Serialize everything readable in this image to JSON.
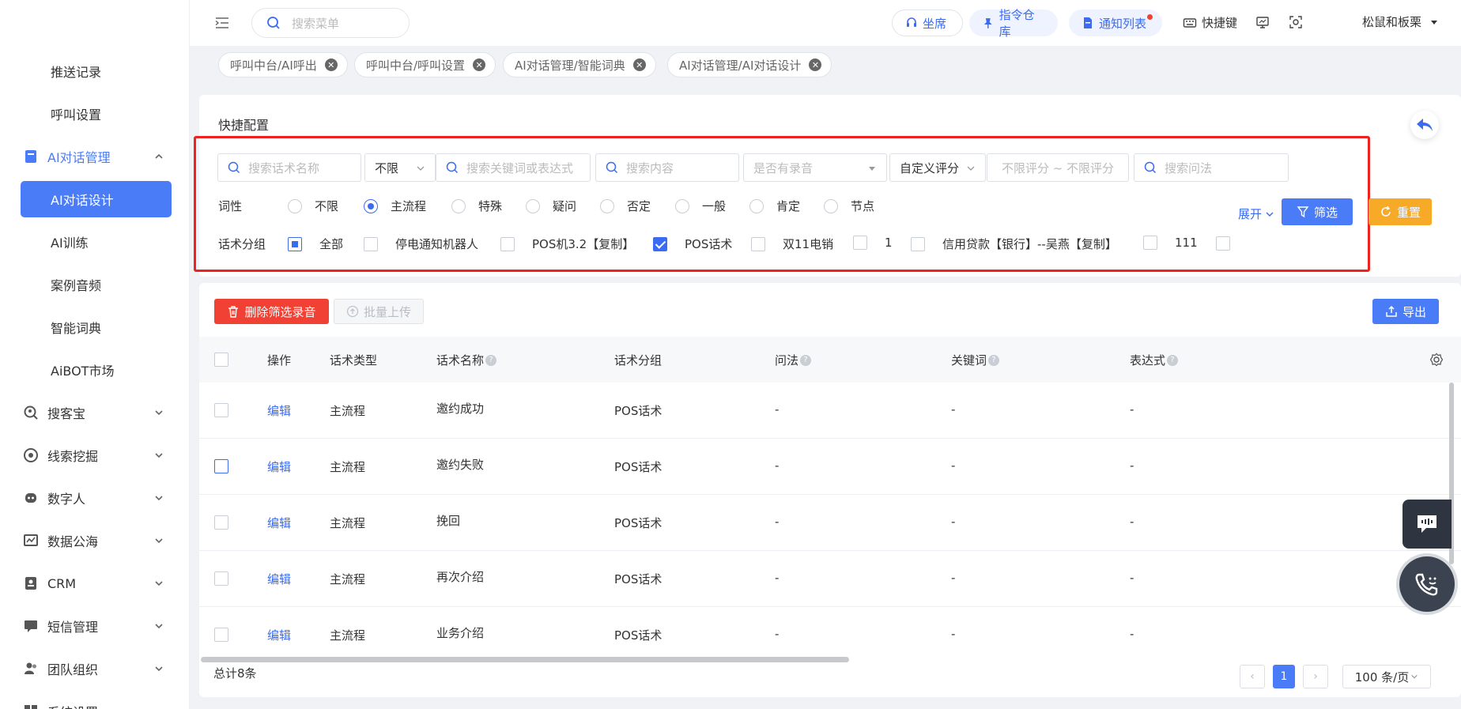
{
  "sidebar": {
    "items": [
      {
        "label": "推送记录"
      },
      {
        "label": "呼叫设置"
      },
      {
        "label": "AI对话管理"
      },
      {
        "label": "AI对话设计"
      },
      {
        "label": "AI训练"
      },
      {
        "label": "案例音频"
      },
      {
        "label": "智能词典"
      },
      {
        "label": "AiBOT市场"
      },
      {
        "label": "搜客宝"
      },
      {
        "label": "线索挖掘"
      },
      {
        "label": "数字人"
      },
      {
        "label": "数据公海"
      },
      {
        "label": "CRM"
      },
      {
        "label": "短信管理"
      },
      {
        "label": "团队组织"
      },
      {
        "label": "系统设置"
      }
    ]
  },
  "header": {
    "search_placeholder": "搜索菜单",
    "seat": "坐席",
    "command_repo": "指令仓库",
    "notify_list": "通知列表",
    "shortcut": "快捷键",
    "user": "松鼠和板栗"
  },
  "tabs": [
    {
      "label": "呼叫中台/AI呼出"
    },
    {
      "label": "呼叫中台/呼叫设置"
    },
    {
      "label": "AI对话管理/智能词典"
    },
    {
      "label": "AI对话管理/AI对话设计"
    }
  ],
  "config": {
    "title": "快捷配置",
    "search_name": "搜索话术名称",
    "limit_select": "不限",
    "search_keyword": "搜索关键词或表达式",
    "search_content": "搜索内容",
    "has_record": "是否有录音",
    "custom_score": "自定义评分",
    "score_range": "不限评分 ~ 不限评分",
    "search_question": "搜索问法",
    "pos_label": "词性",
    "pos_options": [
      "不限",
      "主流程",
      "特殊",
      "疑问",
      "否定",
      "一般",
      "肯定",
      "节点"
    ],
    "group_label": "话术分组",
    "group_options": [
      "全部",
      "停电通知机器人",
      "POS机3.2【复制】",
      "POS话术",
      "双11电销",
      "1",
      "信用贷款【银行】--吴燕【复制】",
      "111"
    ],
    "expand": "展开",
    "filter": "筛选",
    "reset": "重置"
  },
  "toolbar": {
    "delete": "删除筛选录音",
    "upload": "批量上传",
    "export": "导出"
  },
  "table": {
    "columns": [
      "操作",
      "话术类型",
      "话术名称",
      "话术分组",
      "问法",
      "关键词",
      "表达式"
    ],
    "rows": [
      {
        "action": "编辑",
        "type": "主流程",
        "name": "邀约成功",
        "group": "POS话术",
        "question": "-",
        "keyword": "-",
        "expr": "-"
      },
      {
        "action": "编辑",
        "type": "主流程",
        "name": "邀约失败",
        "group": "POS话术",
        "question": "-",
        "keyword": "-",
        "expr": "-"
      },
      {
        "action": "编辑",
        "type": "主流程",
        "name": "挽回",
        "group": "POS话术",
        "question": "-",
        "keyword": "-",
        "expr": "-"
      },
      {
        "action": "编辑",
        "type": "主流程",
        "name": "再次介绍",
        "group": "POS话术",
        "question": "-",
        "keyword": "-",
        "expr": "-"
      },
      {
        "action": "编辑",
        "type": "主流程",
        "name": "业务介绍",
        "group": "POS话术",
        "question": "-",
        "keyword": "-",
        "expr": "-"
      }
    ]
  },
  "pagination": {
    "total": "总计8条",
    "page": "1",
    "size": "100 条/页"
  },
  "colors": {
    "primary": "#4a7cf7",
    "danger": "#f04134",
    "warning": "#f7a928",
    "highlight_box": "#ef2222"
  }
}
